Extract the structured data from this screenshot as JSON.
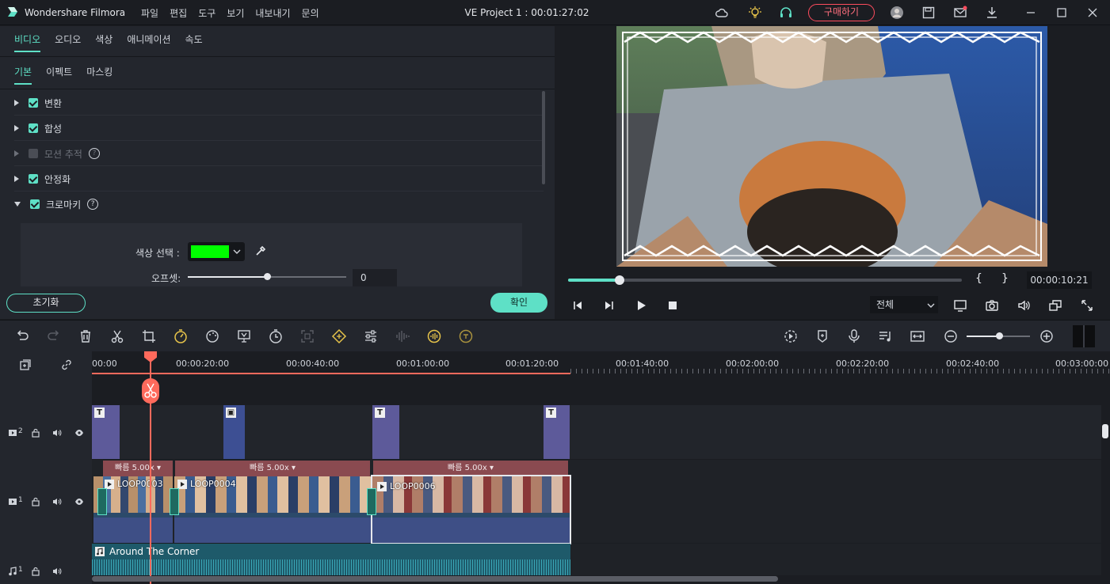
{
  "app": {
    "name": "Wondershare Filmora",
    "project_title": "VE Project 1 : 00:01:27:02",
    "menus": [
      "파일",
      "편집",
      "도구",
      "보기",
      "내보내기",
      "문의"
    ],
    "buy_label": "구매하기"
  },
  "colors": {
    "accent": "#5ee0c6",
    "buy": "#ff4c5e",
    "playhead": "#ff6a5c",
    "chroma_color": "#00ff00"
  },
  "edit_panel": {
    "main_tabs": [
      "비디오",
      "오디오",
      "색상",
      "애니메이션",
      "속도"
    ],
    "sub_tabs": [
      "기본",
      "이펙트",
      "마스킹"
    ],
    "properties": [
      {
        "label": "변환",
        "checked": true
      },
      {
        "label": "합성",
        "checked": true
      },
      {
        "label": "모션 추적",
        "checked": false
      },
      {
        "label": "안정화",
        "checked": true
      },
      {
        "label": "크로마키",
        "checked": true
      }
    ],
    "color_select_label": "색상 선택 :",
    "offset_label": "오프셋:",
    "offset_value": "0",
    "offset_slider_fraction": 0.5,
    "reset_label": "초기화",
    "ok_label": "확인"
  },
  "preview": {
    "time": "00:00:10:21",
    "progress_fraction": 0.13,
    "quality": "전체",
    "mark_in": "{",
    "mark_out": "}"
  },
  "timeline": {
    "ruler": [
      "00:00",
      "00:00:20:00",
      "00:00:40:00",
      "00:01:00:00",
      "00:01:20:00",
      "00:01:40:00",
      "00:02:00:00",
      "00:02:20:00",
      "00:02:40:00",
      "00:03:00:00"
    ],
    "track2_num": "2",
    "track1_num": "1",
    "audio_num": "1",
    "speed_label": "빠름 5.00x",
    "clips": [
      "LOOP0003",
      "LOOP0004",
      "LOOP0006"
    ],
    "audio_clip": "Around The Corner",
    "title_marker": "T"
  }
}
